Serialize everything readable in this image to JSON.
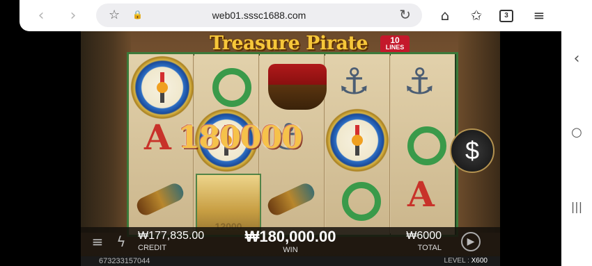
{
  "browser": {
    "url": "web01.sssc1688.com",
    "tab_count": "3",
    "icons": [
      "back-icon",
      "forward-icon",
      "bookmark-star-icon",
      "lock-icon",
      "reload-icon",
      "home-icon",
      "favorites-icon",
      "tabs-icon",
      "menu-icon"
    ]
  },
  "system": {
    "icons": [
      "back-chevron-icon",
      "home-circle-icon",
      "recents-icon"
    ]
  },
  "game": {
    "title": "Treasure Pirate",
    "lines_badge_number": "10",
    "lines_badge_label": "LINES",
    "win_overlay": "180000",
    "treasure_value": "12000",
    "hud": {
      "credit_value": "₩177,835.00",
      "credit_label": "CREDIT",
      "win_value": "₩180,000.00",
      "win_label": "WIN",
      "total_value": "₩6000",
      "total_label": "TOTAL"
    },
    "footer": {
      "round_id": "673233157044",
      "level_label": "LEVEL : ",
      "level_value": "X600"
    }
  }
}
